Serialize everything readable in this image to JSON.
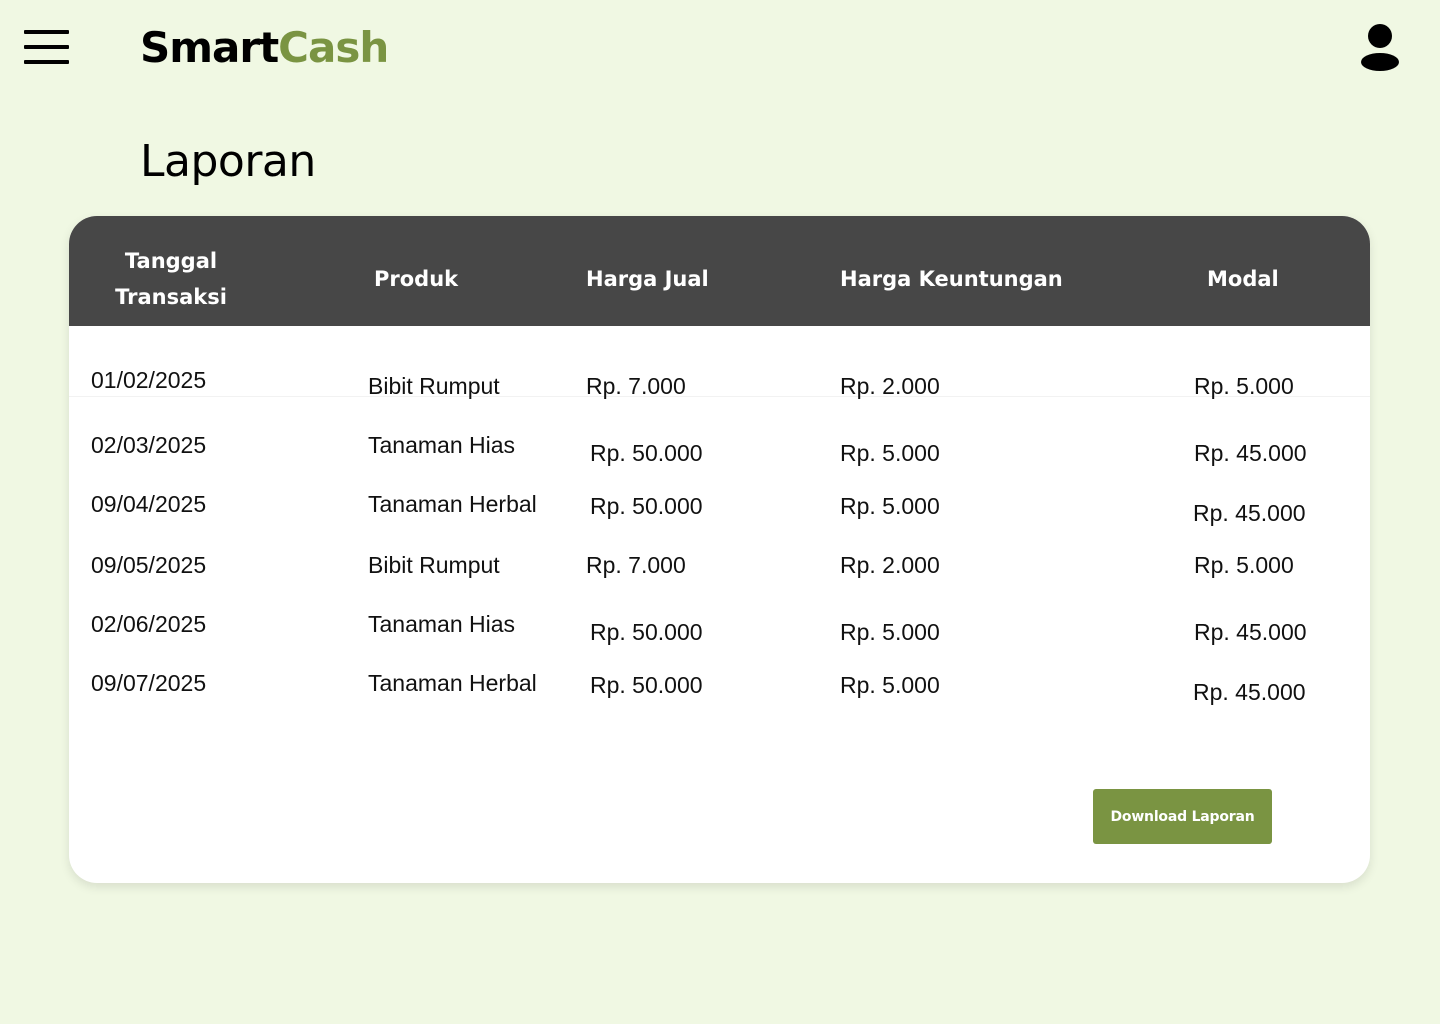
{
  "app": {
    "logo_part1": "Smart",
    "logo_part2": "Cash"
  },
  "page": {
    "title": "Laporan"
  },
  "table": {
    "headers": [
      "Tanggal Transaksi",
      "Produk",
      "Harga Jual",
      "Harga Keuntungan",
      "Modal"
    ],
    "rows": [
      [
        "01/02/2025",
        "Bibit Rumput",
        "Rp. 7.000",
        "Rp. 2.000",
        "Rp. 5.000"
      ],
      [
        "02/03/2025",
        "Tanaman Hias",
        "Rp. 50.000",
        "Rp. 5.000",
        "Rp. 45.000"
      ],
      [
        "09/04/2025",
        "Tanaman Herbal",
        "Rp. 50.000",
        "Rp. 5.000",
        "Rp. 45.000"
      ],
      [
        "09/05/2025",
        "Bibit Rumput",
        "Rp. 7.000",
        "Rp. 2.000",
        "Rp. 5.000"
      ],
      [
        "02/06/2025",
        "Tanaman Hias",
        "Rp. 50.000",
        "Rp. 5.000",
        "Rp. 45.000"
      ],
      [
        "09/07/2025",
        "Tanaman Herbal",
        "Rp. 50.000",
        "Rp. 5.000",
        "Rp. 45.000"
      ]
    ]
  },
  "actions": {
    "download_label": "Download Laporan"
  },
  "icons": {
    "menu": "hamburger-menu-icon",
    "user": "user-profile-icon"
  },
  "colors": {
    "background": "#f0f8e3",
    "accent": "#7a9442",
    "table_header": "#474747",
    "card": "#ffffff"
  }
}
